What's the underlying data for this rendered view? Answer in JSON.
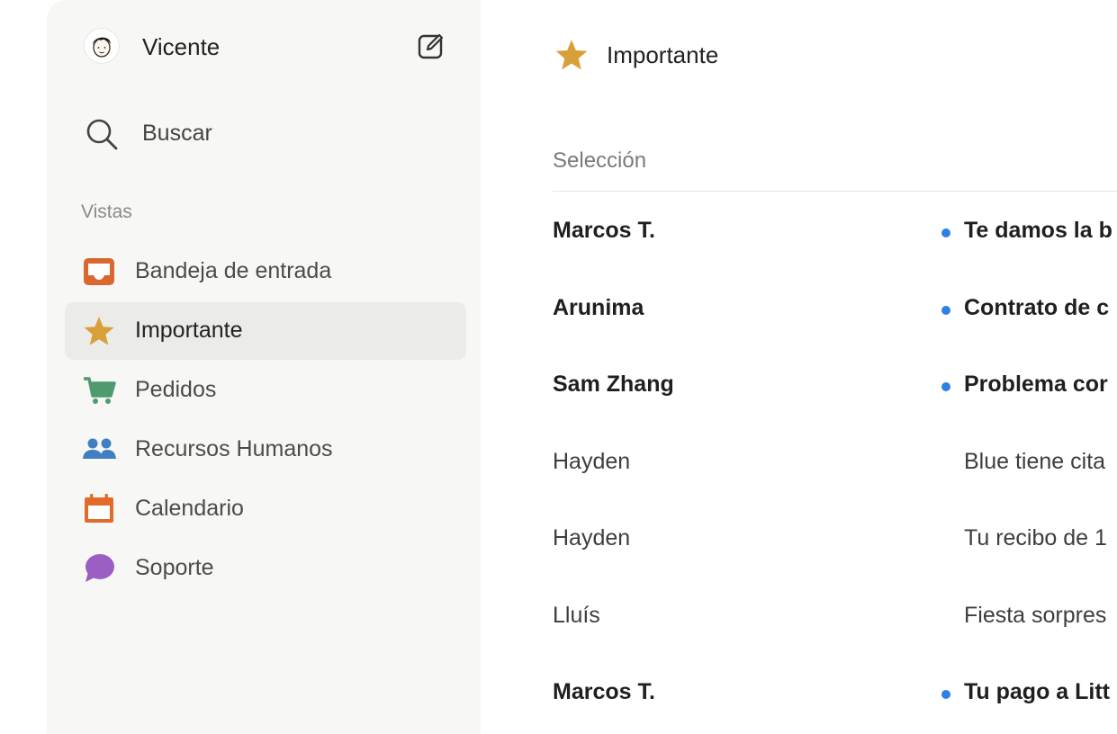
{
  "user": {
    "name": "Vicente",
    "avatar_icon": "user-avatar",
    "compose_icon": "compose-icon"
  },
  "search": {
    "label": "Buscar",
    "icon": "search-icon"
  },
  "sidebar": {
    "section_title": "Vistas",
    "items": [
      {
        "label": "Bandeja de entrada",
        "icon": "inbox-icon",
        "color": "#d9672e",
        "active": false
      },
      {
        "label": "Importante",
        "icon": "star-icon",
        "color": "#d9a03a",
        "active": true
      },
      {
        "label": "Pedidos",
        "icon": "cart-icon",
        "color": "#4f9a6e",
        "active": false
      },
      {
        "label": "Recursos Humanos",
        "icon": "people-icon",
        "color": "#3f7fc1",
        "active": false
      },
      {
        "label": "Calendario",
        "icon": "calendar-icon",
        "color": "#e26b2a",
        "active": false
      },
      {
        "label": "Soporte",
        "icon": "chat-bubble-icon",
        "color": "#9a5ec4",
        "active": false
      }
    ]
  },
  "main": {
    "title": "Importante",
    "title_icon": "star-icon",
    "column_header": "Selección",
    "unread_dot_color": "#2f80e4",
    "rows": [
      {
        "sender": "Marcos T.",
        "subject": "Te damos la b",
        "unread": true
      },
      {
        "sender": "Arunima",
        "subject": "Contrato de c",
        "unread": true
      },
      {
        "sender": "Sam Zhang",
        "subject": "Problema cor",
        "unread": true
      },
      {
        "sender": "Hayden",
        "subject": "Blue tiene cita",
        "unread": false
      },
      {
        "sender": "Hayden",
        "subject": "Tu recibo de 1",
        "unread": false
      },
      {
        "sender": "Lluís",
        "subject": "Fiesta sorpres",
        "unread": false
      },
      {
        "sender": "Marcos T.",
        "subject": "Tu pago a Litt",
        "unread": true
      }
    ]
  }
}
